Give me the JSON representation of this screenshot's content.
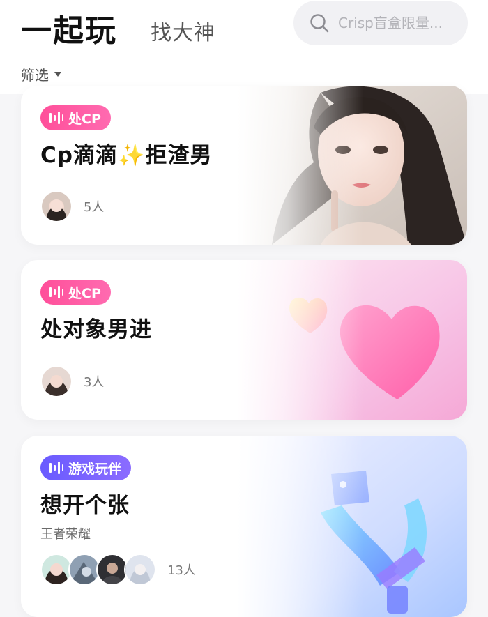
{
  "header": {
    "tab_active": "一起玩",
    "tab_inactive": "找大神",
    "search_placeholder": "Crisp盲盒限量...",
    "filter_label": "筛选"
  },
  "cards": [
    {
      "tag": "处CP",
      "tag_color": "#ff4f9a",
      "title": "Cp滴滴✨拒渣男",
      "count": "5人",
      "icon": "sound-wave-icon",
      "art": "portrait-photo"
    },
    {
      "tag": "处CP",
      "tag_color": "#ff4f9a",
      "title": "处对象男进",
      "count": "3人",
      "icon": "sound-wave-icon",
      "art": "heart-illustration"
    },
    {
      "tag": "游戏玩伴",
      "tag_color": "#6a5bff",
      "title": "想开个张",
      "subtitle": "王者荣耀",
      "count": "13人",
      "icon": "sound-wave-icon",
      "art": "gamepad-sword-illustration"
    }
  ],
  "colors": {
    "tag_pink": "#ff4f9a",
    "tag_purple": "#6a5bff",
    "search_bg": "#f1f1f4"
  }
}
